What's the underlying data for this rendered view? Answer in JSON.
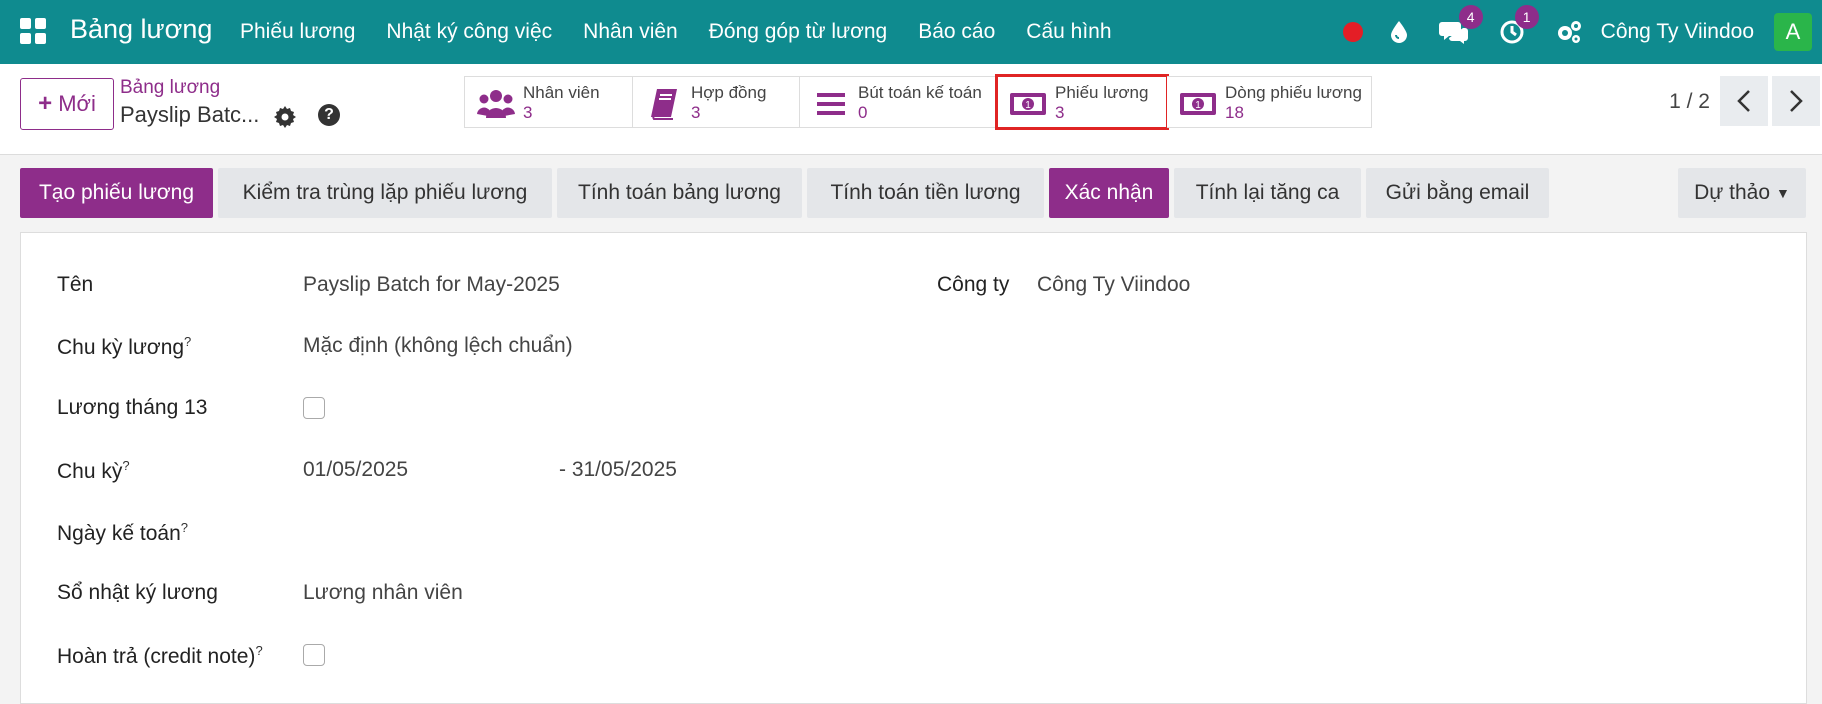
{
  "navbar": {
    "brand": "Bảng lương",
    "menu": [
      "Phiếu lương",
      "Nhật ký công việc",
      "Nhân viên",
      "Đóng góp từ lương",
      "Báo cáo",
      "Cấu hình"
    ],
    "messages_badge": "4",
    "activities_badge": "1",
    "company": "Công Ty Viindoo",
    "avatar_letter": "A",
    "colors": {
      "bar": "#0f8b8f",
      "accent": "#8e2d8a",
      "record_dot": "#e41e26",
      "avatar": "#2ab54a"
    }
  },
  "control_panel": {
    "new_button": "Mới",
    "breadcrumb_parent": "Bảng lương",
    "record_title": "Payslip Batc...",
    "smart_buttons": [
      {
        "label": "Nhân viên",
        "count": "3",
        "icon": "users-icon"
      },
      {
        "label": "Hợp đồng",
        "count": "3",
        "icon": "book-icon"
      },
      {
        "label": "Bút toán kế toán",
        "count": "0",
        "icon": "list-icon"
      },
      {
        "label": "Phiếu lương",
        "count": "3",
        "icon": "money-icon"
      },
      {
        "label": "Dòng phiếu lương",
        "count": "18",
        "icon": "money-icon"
      }
    ],
    "pager": "1 / 2"
  },
  "statusbar": {
    "actions": [
      "Tạo phiếu lương",
      "Kiểm tra trùng lặp phiếu lương",
      "Tính toán bảng lương",
      "Tính toán tiền lương",
      "Xác nhận",
      "Tính lại tăng ca",
      "Gửi bằng email"
    ],
    "state": "Dự thảo"
  },
  "form": {
    "name_label": "Tên",
    "name_value": "Payslip Batch for May-2025",
    "company_label": "Công ty",
    "company_value": "Công Ty Viindoo",
    "cycle_label": "Chu kỳ lương",
    "cycle_value": "Mặc định (không lệch chuẩn)",
    "thirteenth_label": "Lương tháng 13",
    "thirteenth_checked": false,
    "period_label": "Chu kỳ",
    "period_from": "01/05/2025",
    "period_to": "- 31/05/2025",
    "accounting_date_label": "Ngày kế toán",
    "accounting_date_value": "",
    "journal_label": "Sổ nhật ký lương",
    "journal_value": "Lương nhân viên",
    "credit_note_label": "Hoàn trả (credit note)",
    "credit_note_checked": false,
    "help_mark": "?"
  }
}
